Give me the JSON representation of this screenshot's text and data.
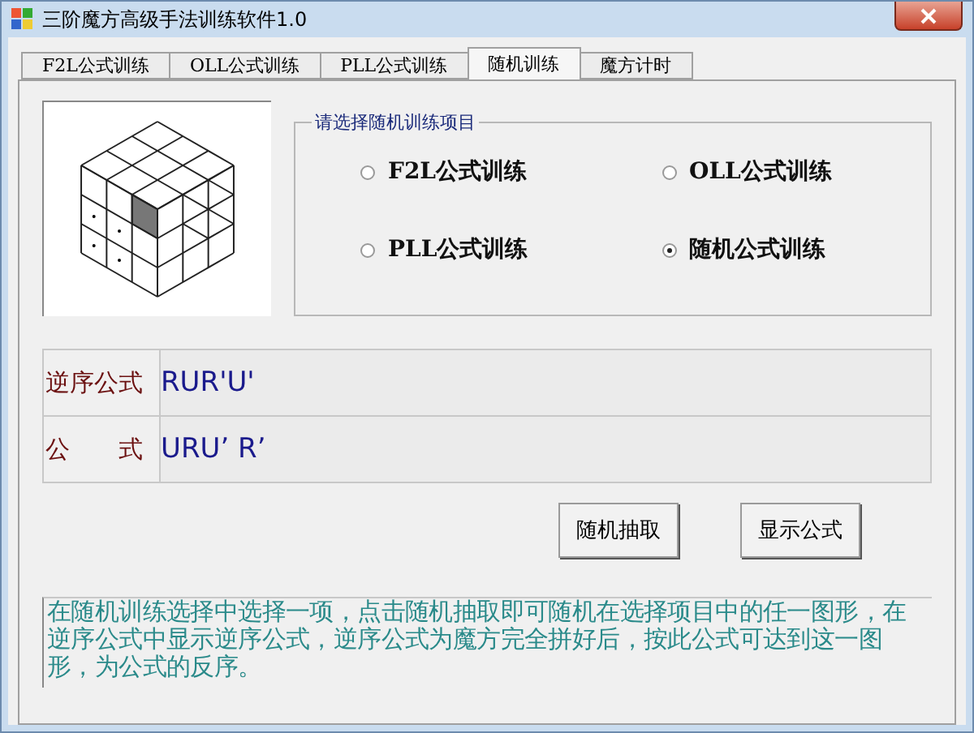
{
  "window": {
    "title": "三阶魔方高级手法训练软件1.0"
  },
  "tabs": [
    {
      "label": "F2L公式训练",
      "selected": false
    },
    {
      "label": "OLL公式训练",
      "selected": false
    },
    {
      "label": "PLL公式训练",
      "selected": false
    },
    {
      "label": "随机训练",
      "selected": true
    },
    {
      "label": "魔方计时",
      "selected": false
    }
  ],
  "group": {
    "title": "请选择随机训练项目",
    "options": [
      {
        "label": "F2L公式训练",
        "selected": false
      },
      {
        "label": "OLL公式训练",
        "selected": false
      },
      {
        "label": "PLL公式训练",
        "selected": false
      },
      {
        "label": "随机公式训练",
        "selected": true
      }
    ]
  },
  "formulas": [
    {
      "label": "逆序公式",
      "value": "RUR'U'"
    },
    {
      "label": "公　　式",
      "value": "URU’ R’"
    }
  ],
  "buttons": [
    "随机抽取",
    "显示公式"
  ],
  "description": "在随机训练选择中选择一项，点击随机抽取即可随机在选择项目中的任一图形，在逆序公式中显示逆序公式，逆序公式为魔方完全拼好后，按此公式可达到这一图形，为公式的反序。"
}
